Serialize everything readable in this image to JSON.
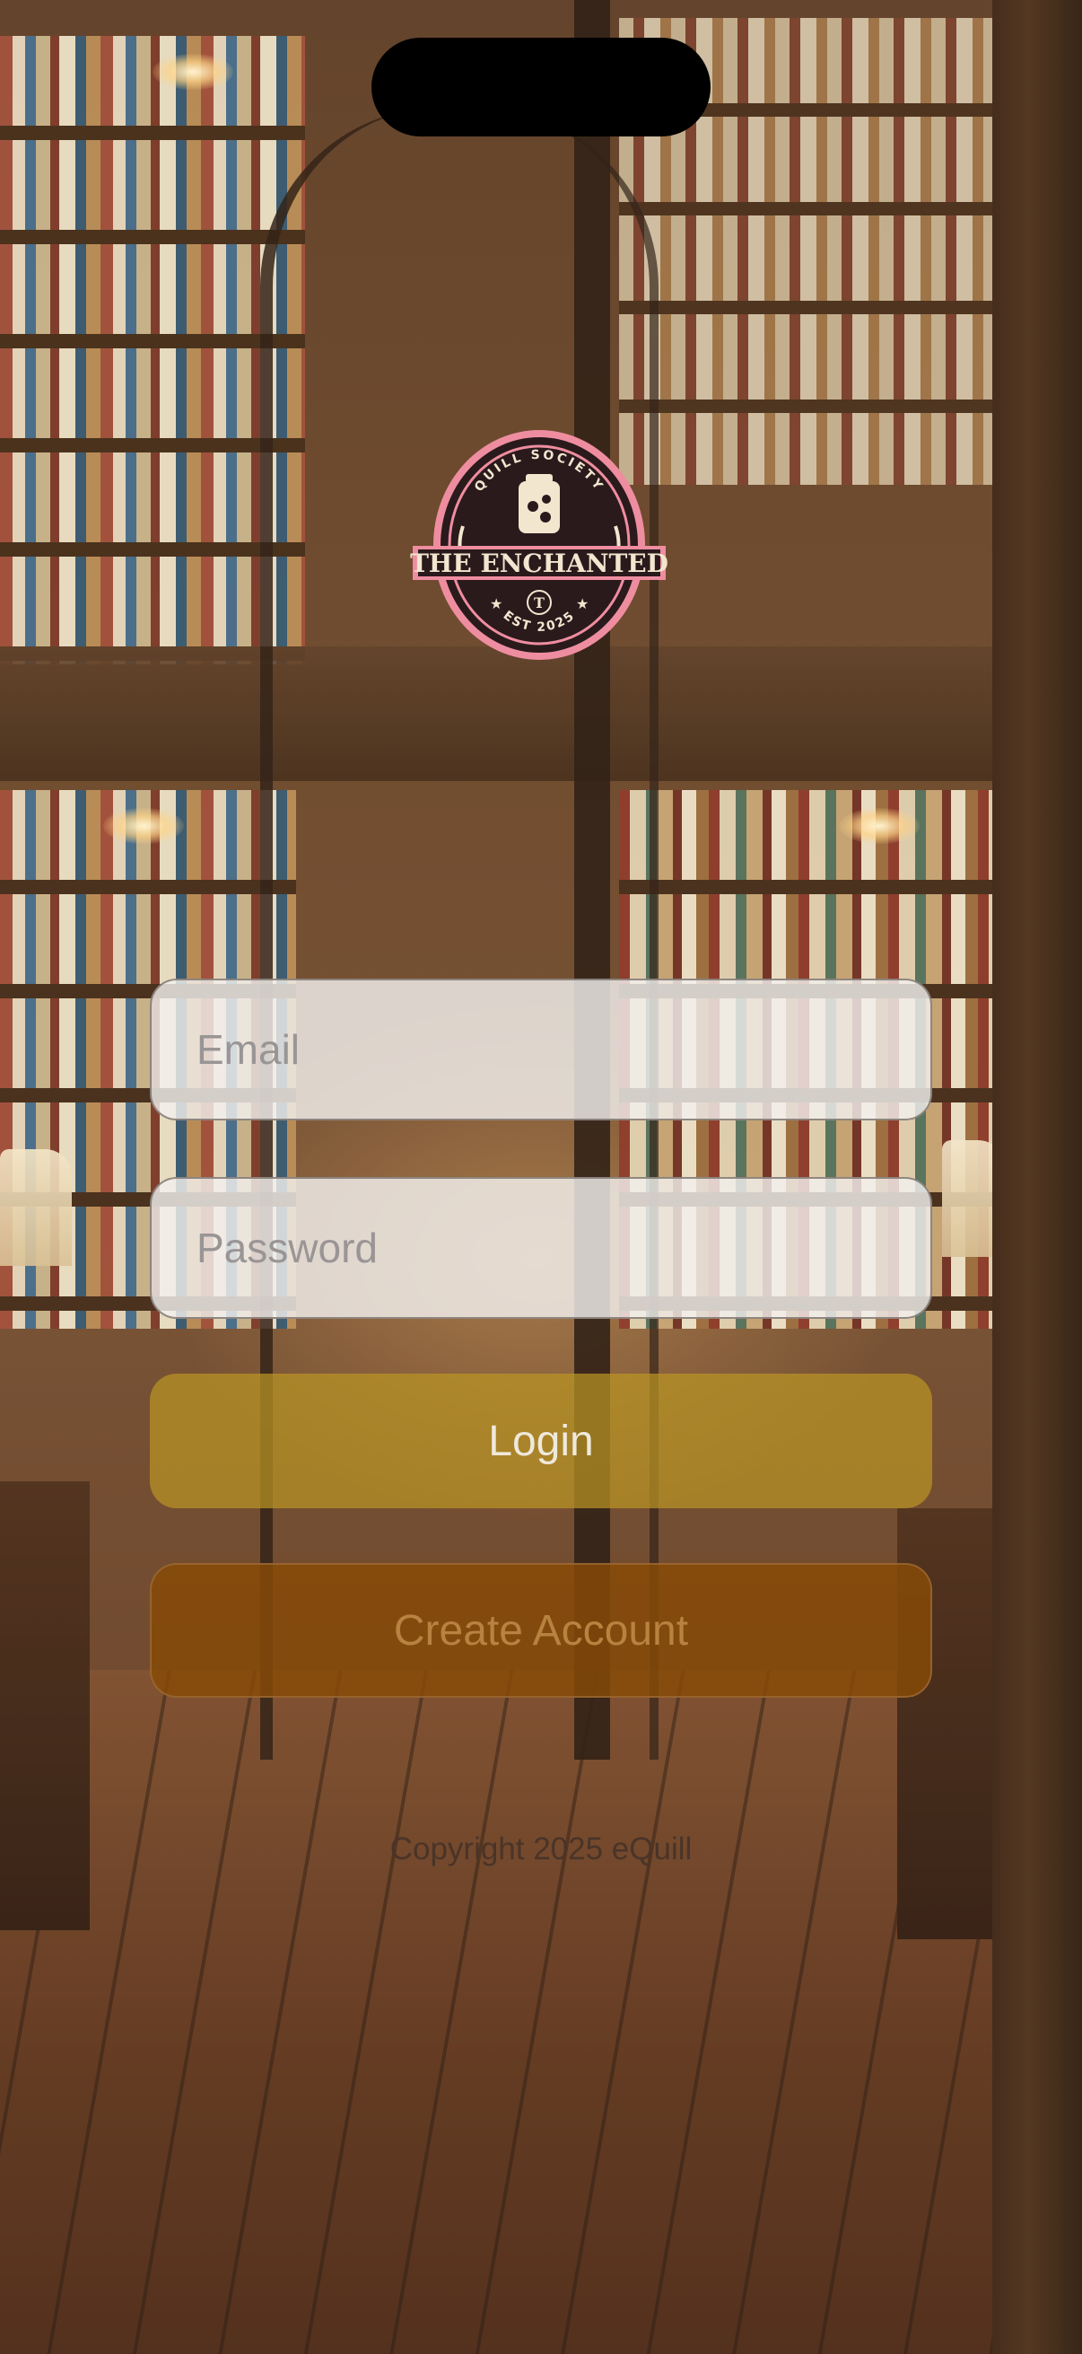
{
  "logo": {
    "arc_text": "QUILL SOCIETY",
    "title": "THE ENCHANTED",
    "initial": "T",
    "est_text": "EST 2025",
    "colors": {
      "pink": "#ef8da0",
      "dark": "#2a1a1c",
      "cream": "#f2e6cf"
    }
  },
  "form": {
    "email_placeholder": "Email",
    "password_placeholder": "Password",
    "login_label": "Login",
    "create_account_label": "Create Account"
  },
  "footer": {
    "copyright": "Copyright 2025 eQuill"
  },
  "colors": {
    "login_button": "#ba9424",
    "create_button": "#884a06",
    "create_text": "#b88240"
  }
}
